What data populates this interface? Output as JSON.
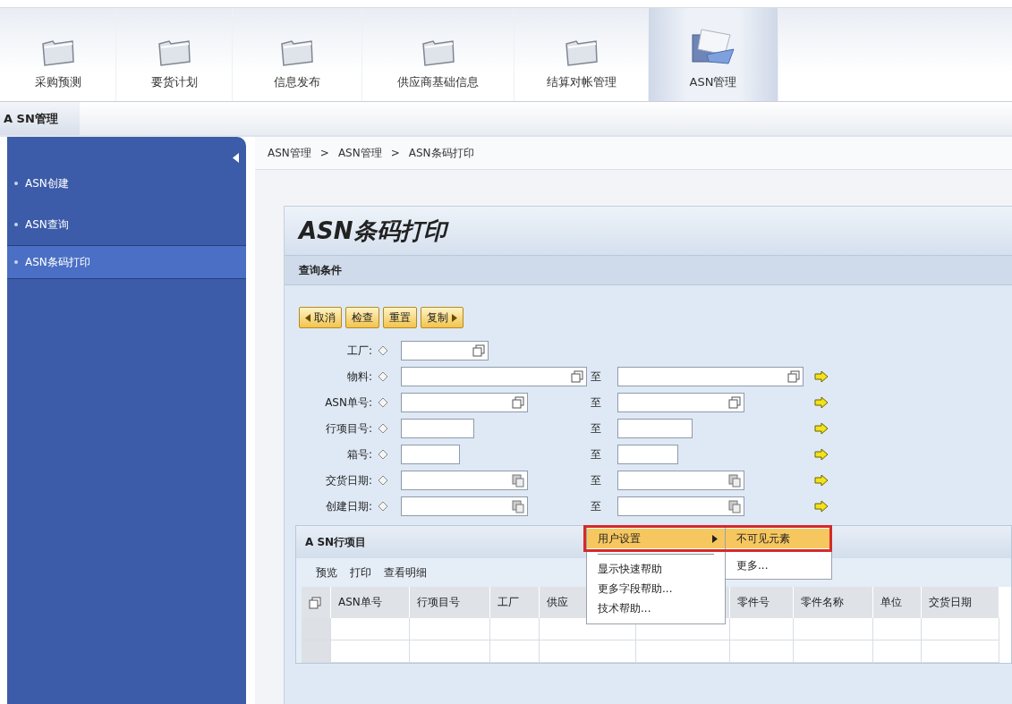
{
  "top_tabs": [
    {
      "label": "采购预测",
      "selected": false
    },
    {
      "label": "要货计划",
      "selected": false
    },
    {
      "label": "信息发布",
      "selected": false
    },
    {
      "label": "供应商基础信息",
      "selected": false
    },
    {
      "label": "结算对帐管理",
      "selected": false
    },
    {
      "label": "ASN管理",
      "selected": true
    }
  ],
  "sub_tabs": [
    {
      "label": "A SN管理",
      "selected": true
    }
  ],
  "sidebar": {
    "items": [
      {
        "label": "ASN创建",
        "selected": false
      },
      {
        "label": "ASN查询",
        "selected": false
      },
      {
        "label": "ASN条码打印",
        "selected": true
      }
    ]
  },
  "breadcrumb": [
    "ASN管理",
    "ASN管理",
    "ASN条码打印"
  ],
  "breadcrumb_separator": ">",
  "page_title": "ASN条码打印",
  "query_section": {
    "title": "查询条件",
    "buttons": [
      {
        "label": "取消",
        "kind": "back"
      },
      {
        "label": "检查",
        "kind": "plain"
      },
      {
        "label": "重置",
        "kind": "plain"
      },
      {
        "label": "复制",
        "kind": "forward"
      }
    ],
    "fields": [
      {
        "label": "工厂:",
        "kind": "lookup"
      },
      {
        "label": "物料:",
        "kind": "lookup",
        "to_label": "至"
      },
      {
        "label": "ASN单号:",
        "kind": "lookup",
        "to_label": "至"
      },
      {
        "label": "行项目号:",
        "kind": "plain",
        "to_label": "至"
      },
      {
        "label": "箱号:",
        "kind": "plain",
        "to_label": "至"
      },
      {
        "label": "交货日期:",
        "kind": "date",
        "to_label": "至"
      },
      {
        "label": "创建日期:",
        "kind": "date",
        "to_label": "至"
      }
    ]
  },
  "items_section": {
    "title": "A SN行项目",
    "toolbar": [
      "预览",
      "打印",
      "查看明细"
    ],
    "columns": [
      "ASN单号",
      "行项目号",
      "工厂",
      "供应",
      "零件号",
      "零件名称",
      "单位",
      "交货日期"
    ]
  },
  "context_menu": {
    "items": [
      {
        "label": "用户设置",
        "kind": "submenu",
        "selected": true
      },
      {
        "kind": "separator"
      },
      {
        "label": "显示快速帮助",
        "kind": "item",
        "selected": false
      },
      {
        "label": "更多字段帮助...",
        "kind": "item",
        "selected": false
      },
      {
        "label": "技术帮助...",
        "kind": "item",
        "selected": false
      }
    ],
    "submenu": [
      {
        "label": "不可见元素",
        "selected": true
      },
      {
        "label": "更多...",
        "selected": false
      }
    ]
  }
}
